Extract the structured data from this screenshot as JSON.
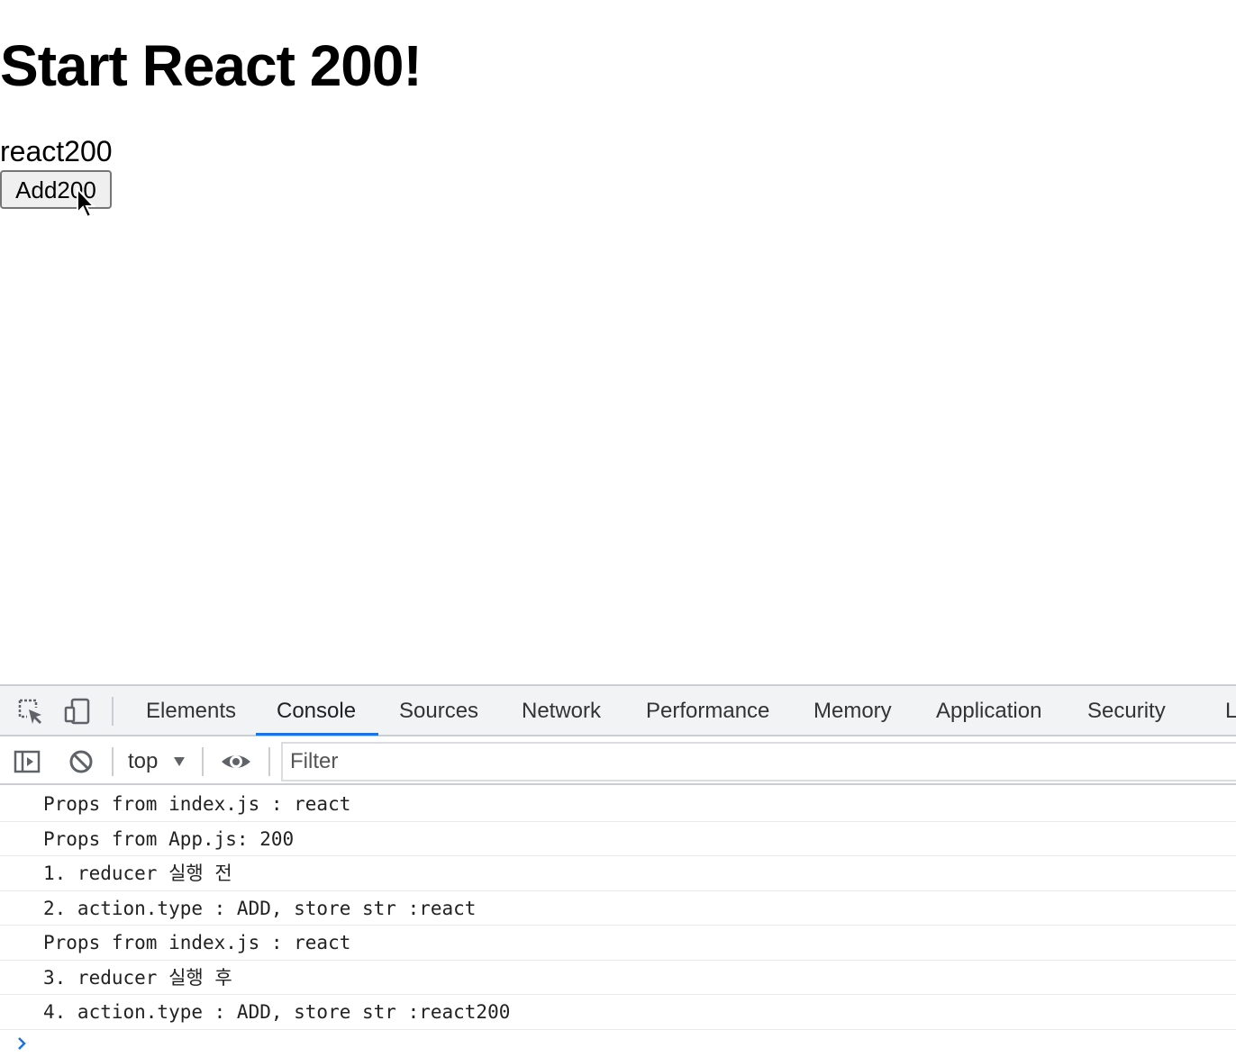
{
  "page": {
    "title": "Start React 200!",
    "str_value": "react200",
    "add_button_label": "Add200"
  },
  "devtools": {
    "tabs": [
      {
        "label": "Elements"
      },
      {
        "label": "Console",
        "active": true
      },
      {
        "label": "Sources"
      },
      {
        "label": "Network"
      },
      {
        "label": "Performance"
      },
      {
        "label": "Memory"
      },
      {
        "label": "Application"
      },
      {
        "label": "Security"
      },
      {
        "label": "L"
      }
    ],
    "toolbar": {
      "context": "top",
      "filter_placeholder": "Filter"
    },
    "console": {
      "messages": [
        "Props from index.js : react",
        "Props from App.js: 200",
        "1. reducer 실행 전",
        "2. action.type : ADD, store str :react",
        "Props from index.js : react",
        "3. reducer 실행 후",
        "4. action.type : ADD, store str :react200"
      ]
    },
    "colors": {
      "active_tab_underline": "#1a73e8",
      "prompt_chevron": "#1a73e8",
      "tabbar_bg": "#f1f3f4"
    }
  }
}
